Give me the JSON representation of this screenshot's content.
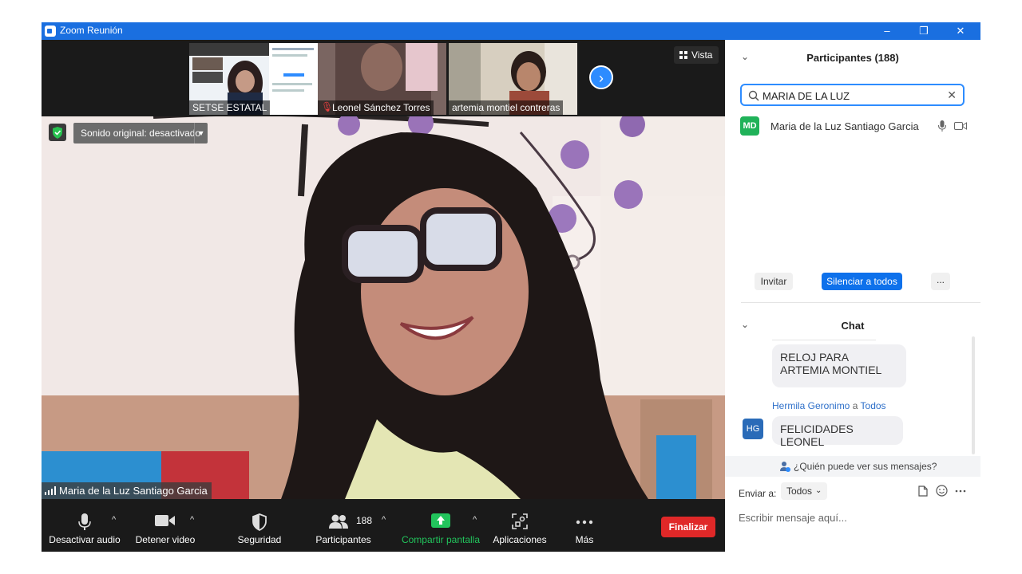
{
  "window": {
    "title": "Zoom Reunión",
    "controls": [
      "–",
      "❐",
      "✕"
    ]
  },
  "thumbnails": [
    {
      "name": "SETSE ESTATAL",
      "muted": false
    },
    {
      "name": "Leonel Sánchez Torres",
      "muted": true
    },
    {
      "name": "artemia montiel contreras",
      "muted": false
    }
  ],
  "view": {
    "label": "Vista"
  },
  "audio_notice": {
    "label": "Sonido original: desactivado"
  },
  "speaker": {
    "name": "Maria de la Luz Santiago Garcia"
  },
  "toolbar": {
    "audio": "Desactivar audio",
    "video": "Detener video",
    "security": "Seguridad",
    "participants": "Participantes",
    "participants_count": "188",
    "share": "Compartir pantalla",
    "apps": "Aplicaciones",
    "more": "Más",
    "end": "Finalizar"
  },
  "participants_panel": {
    "title": "Participantes (188)",
    "search_value": "MARIA DE LA LUZ",
    "results": [
      {
        "initials": "MD",
        "name": "Maria de la Luz Santiago Garcia",
        "avatar_color": "#20b259"
      }
    ],
    "invite": "Invitar",
    "mute_all": "Silenciar a todos",
    "more": "..."
  },
  "chat": {
    "title": "Chat",
    "messages": [
      {
        "text": "RELOJ PARA ARTEMIA MONTIEL"
      },
      {
        "sender": "Hermila Geronimo",
        "connector": "a",
        "recipient": "Todos",
        "initials": "HG",
        "text": "FELICIDADES LEONEL"
      }
    ],
    "who_can_see": "¿Quién puede ver sus mensajes?",
    "send_to_label": "Enviar a:",
    "send_to_value": "Todos",
    "placeholder": "Escribir mensaje aquí..."
  },
  "colors": {
    "accent": "#2d8cff",
    "title_bar": "#1a6fe0",
    "end_button": "#e02828",
    "share_green": "#22c45c"
  }
}
